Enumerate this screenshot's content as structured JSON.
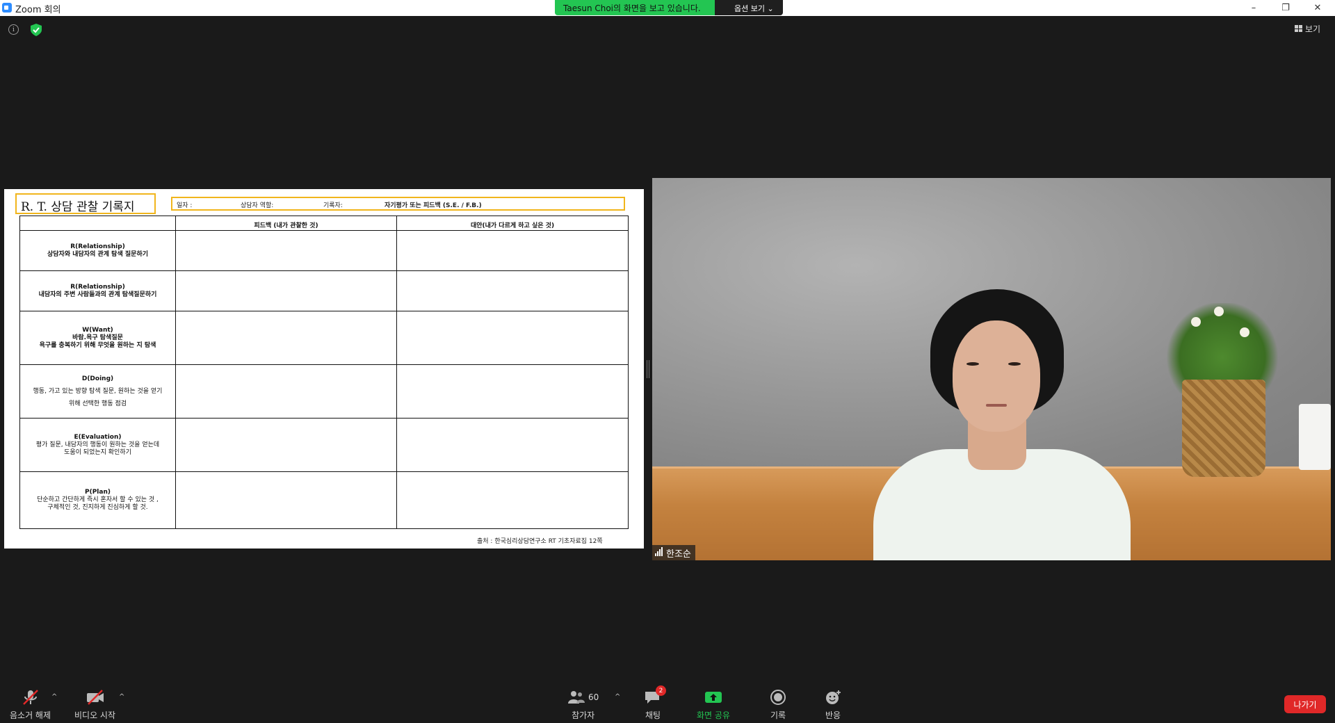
{
  "window": {
    "title": "Zoom 회의",
    "minimize": "–",
    "restore": "❐",
    "close": "✕"
  },
  "share_banner": {
    "status": "Taesun Choi의 화면을 보고 있습니다.",
    "options": "옵션 보기 ⌄"
  },
  "top": {
    "info_glyph": "i",
    "view_label": "보기"
  },
  "document": {
    "title": "R. T. 상담 관찰 기록지",
    "header": {
      "date": "일자 :",
      "role": "상담자 역할:",
      "recorder": "기록자:",
      "evaluation": "자기평가 또는 피드백 (S.E. / F.B.)"
    },
    "columns": [
      "피드백 (내가 관찰한 것)",
      "대안(내가 다르게 하고 싶은 것)"
    ],
    "rows": [
      {
        "head": "R(Relationship)",
        "desc": "상담자와 내담자의 관계 탐색 질문하기"
      },
      {
        "head": "R(Relationship)",
        "desc": "내담자의 주변 사람들과의 관계 탐색질문하기"
      },
      {
        "head": "W(Want)",
        "desc": "바람.욕구 탐색질문",
        "desc2": "욕구를 충복하기 위해 무엇을 원하는 지 탐색"
      },
      {
        "head": "D(Doing)",
        "desc": "행동, 가고 있는 방향 탐색 질문, 원하는 것을 얻기",
        "desc2": "위해 선택한 행동 점검"
      },
      {
        "head": "E(Evaluation)",
        "desc": "평가 질문, 내담자의 행동이 원하는 것을 얻는데",
        "desc2": "도움이 되었는지 확인하기"
      },
      {
        "head": "P(Plan)",
        "desc": "단순하고 간단하게 즉시 혼자서 할 수 있는 것 ,",
        "desc2": "구체적인 것, 진지하게 진심하게 할 것."
      }
    ],
    "source": "출처 : 한국심리상담연구소 RT 기초자료집 12쪽"
  },
  "participant": {
    "name": "한조순"
  },
  "toolbar": {
    "unmute": "음소거 해제",
    "start_video": "비디오 시작",
    "participants": "참가자",
    "participants_count": "60",
    "chat": "채팅",
    "chat_badge": "2",
    "share_screen": "화면 공유",
    "record": "기록",
    "reactions": "반응",
    "leave": "나가기",
    "caret": "^"
  },
  "colors": {
    "share_green": "#23c552",
    "leave_red": "#e02828",
    "doc_border": "#f1b51c"
  }
}
